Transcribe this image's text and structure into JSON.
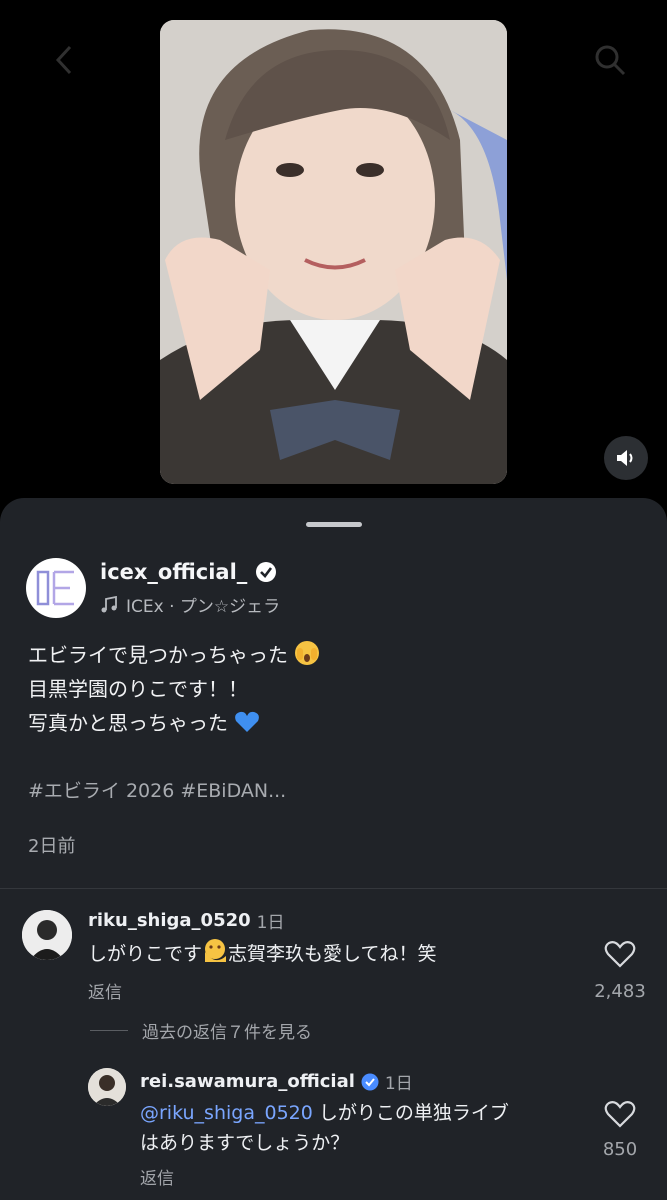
{
  "post": {
    "username": "icex_official_",
    "music": "ICEx · プン☆ジェラ",
    "caption_lines": [
      "エビライで見つかっちゃった",
      "目黒学園のりこです！！",
      "写真かと思っちゃった"
    ],
    "hashtags": "#エビライ 2026 #EBiDAN...",
    "time_ago": "2日前"
  },
  "comments": [
    {
      "username": "riku_shiga_0520",
      "time": "1日",
      "text_before": "しがりこです",
      "text_after": "志賀李玖も愛してね！笑",
      "reply_label": "返信",
      "likes": "2,483"
    }
  ],
  "view_replies": "過去の返信７件を見る",
  "reply": {
    "username": "rei.sawamura_official",
    "time": "1日",
    "mention": "@riku_shiga_0520",
    "text_line1": " しがりこの単独ライブ",
    "text_line2": "はありますでしょうか？",
    "reply_label": "返信",
    "likes": "850"
  },
  "icons": [
    "back-arrow-icon",
    "search-icon",
    "sound-icon",
    "verified-icon",
    "music-note-icon",
    "heart-icon"
  ],
  "colors": {
    "sheet_bg": "#202328",
    "verified": "#4a8cff",
    "mention": "#7aa6ff"
  }
}
